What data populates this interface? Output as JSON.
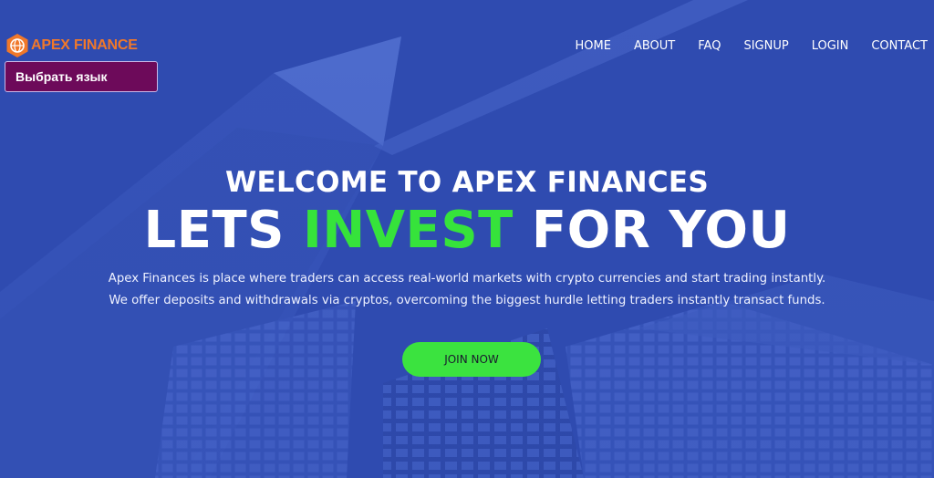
{
  "brand": {
    "name": "APEX FINANCE",
    "logo_icon": "globe-hexagon-icon",
    "color": "#f0782a"
  },
  "language_selector": {
    "label": "Выбрать язык",
    "color": "#6d0a5a"
  },
  "nav": {
    "items": [
      {
        "label": "HOME"
      },
      {
        "label": "ABOUT"
      },
      {
        "label": "FAQ"
      },
      {
        "label": "SIGNUP"
      },
      {
        "label": "LOGIN"
      },
      {
        "label": "CONTACT"
      }
    ]
  },
  "hero": {
    "welcome": "WELCOME TO APEX FINANCES",
    "tagline_start": "LETS ",
    "tagline_accent": "INVEST",
    "tagline_end": " FOR YOU",
    "description_line1": "Apex Finances is place where traders can access real-world markets with crypto currencies and start trading instantly.",
    "description_line2": "We offer deposits and withdrawals via cryptos, overcoming the biggest hurdle letting traders instantly transact funds.",
    "cta_label": "JOIN NOW",
    "accent_color": "#36e33b",
    "background_color": "#2f4bb0"
  }
}
